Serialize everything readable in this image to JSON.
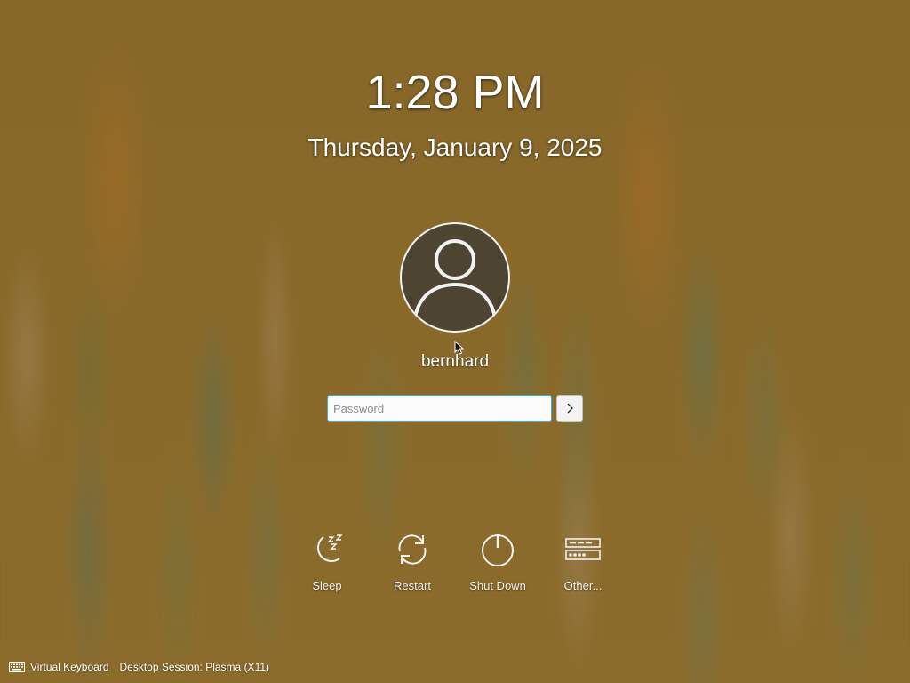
{
  "screen": {
    "clock": "1:28 PM",
    "date": "Thursday, January 9, 2025"
  },
  "user": {
    "name": "bernhard",
    "avatar_icon": "user-avatar-icon"
  },
  "login": {
    "password_placeholder": "Password",
    "password_value": "",
    "submit_icon": "chevron-right-icon"
  },
  "actions": [
    {
      "label": "Sleep",
      "icon": "sleep-moon-icon"
    },
    {
      "label": "Restart",
      "icon": "restart-icon"
    },
    {
      "label": "Shut Down",
      "icon": "power-icon"
    },
    {
      "label": "Other...",
      "icon": "other-users-icon"
    }
  ],
  "footer": {
    "virtual_keyboard": "Virtual Keyboard",
    "session": "Desktop Session: Plasma (X11)",
    "keyboard_icon": "keyboard-icon"
  },
  "colors": {
    "accent": "#3daee9",
    "background": "#8a6a28",
    "avatar_fill": "#4d4432"
  }
}
